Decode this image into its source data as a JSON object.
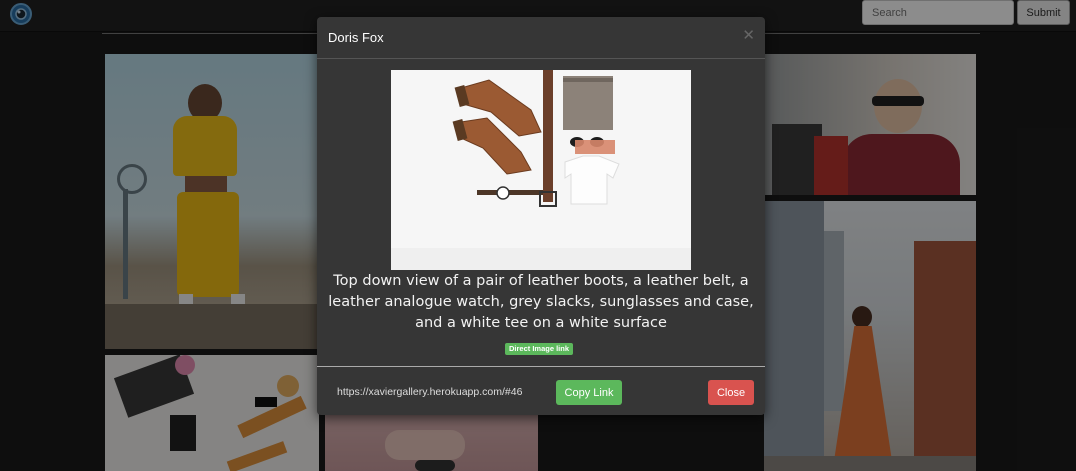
{
  "navbar": {
    "logo_icon": "camera-lens-icon",
    "search_placeholder": "Search",
    "submit_label": "Submit"
  },
  "gallery": {
    "tiles": [
      {
        "name": "yellow-tracksuit-woman-photo"
      },
      {
        "name": "red-coat-shopping-photo"
      },
      {
        "name": "flatlay-desk-photo"
      },
      {
        "name": "pink-dress-hands-photo"
      },
      {
        "name": "orange-dress-street-photo"
      }
    ]
  },
  "modal": {
    "title": "Doris Fox",
    "close_icon": "close-icon",
    "description": "Top down view of a pair of leather boots, a leather belt, a leather analogue watch, grey slacks, sunglasses and case, and a white tee on a white surface",
    "direct_link_label": "Direct Image link",
    "url": "https://xaviergallery.herokuapp.com/#46",
    "copy_label": "Copy Link",
    "close_label": "Close"
  },
  "colors": {
    "background": "#1b1b1b",
    "modal": "#363636",
    "success": "#5cb85c",
    "danger": "#d9534f"
  }
}
